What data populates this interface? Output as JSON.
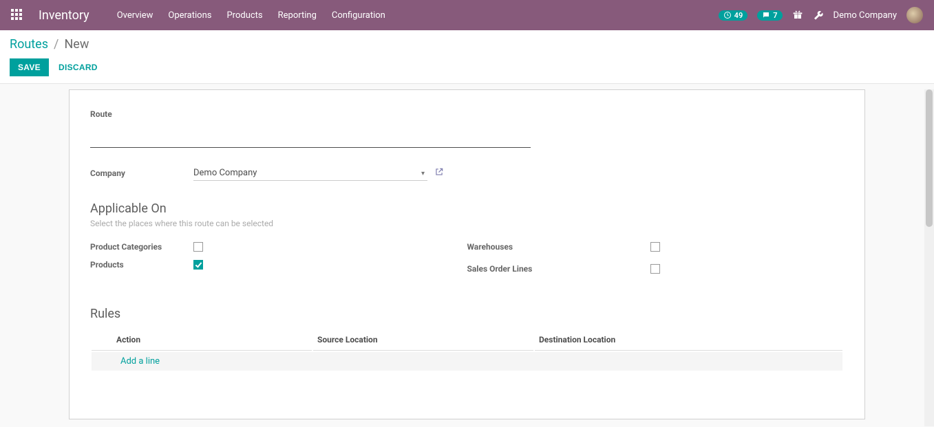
{
  "topbar": {
    "brand": "Inventory",
    "menu": [
      "Overview",
      "Operations",
      "Products",
      "Reporting",
      "Configuration"
    ],
    "activity_count": "49",
    "msg_count": "7",
    "company": "Demo Company"
  },
  "breadcrumb": {
    "parent": "Routes",
    "sep": "/",
    "current": "New"
  },
  "buttons": {
    "save": "SAVE",
    "discard": "DISCARD"
  },
  "form": {
    "route_label": "Route",
    "route_value": "",
    "company_label": "Company",
    "company_value": "Demo Company",
    "section_applicable": "Applicable On",
    "section_applicable_help": "Select the places where this route can be selected",
    "checks": {
      "product_categories": {
        "label": "Product Categories",
        "checked": false
      },
      "products": {
        "label": "Products",
        "checked": true
      },
      "warehouses": {
        "label": "Warehouses",
        "checked": false
      },
      "sales_order_lines": {
        "label": "Sales Order Lines",
        "checked": false
      }
    },
    "section_rules": "Rules",
    "rules_columns": {
      "action": "Action",
      "src": "Source Location",
      "dst": "Destination Location"
    },
    "add_line": "Add a line"
  }
}
